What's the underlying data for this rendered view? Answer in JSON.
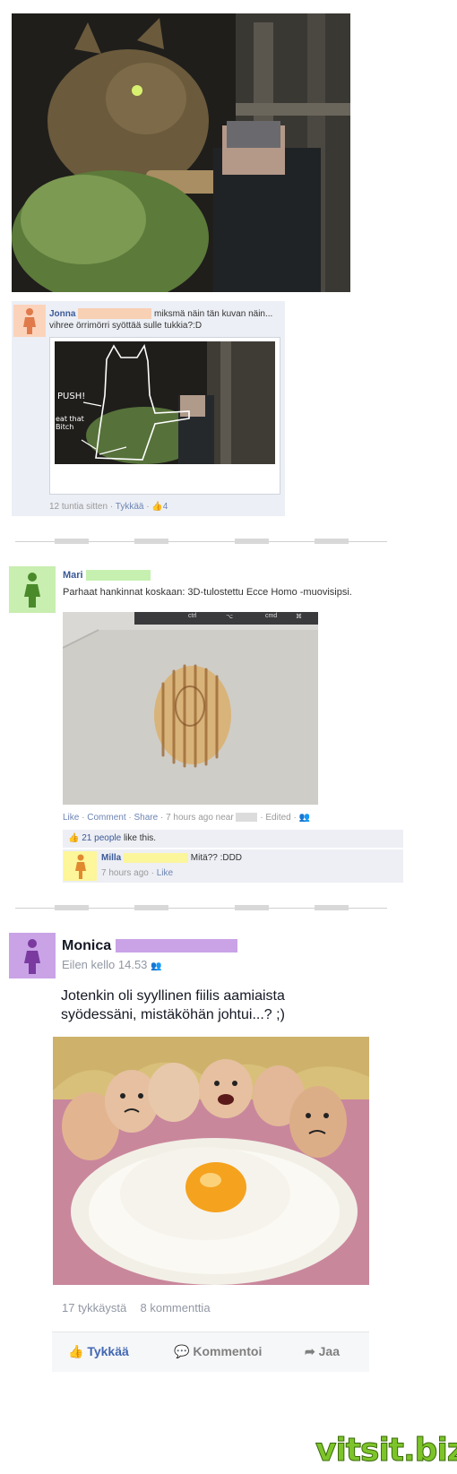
{
  "post1": {
    "comment": {
      "name": "Jonna",
      "text": "miksmä näin tän kuvan näin... vihree örrimörri syöttää sulle tukkia?:D",
      "time": "12 tuntia sitten",
      "like": "Tykkää",
      "likes": "4"
    },
    "doodle": {
      "push": "PUSH!",
      "eat": "eat that Bitch"
    }
  },
  "post2": {
    "name": "Mari",
    "text": "Parhaat hankinnat koskaan: 3D-tulostettu Ecce Homo -muovisipsi.",
    "actions": {
      "like": "Like",
      "comment": "Comment",
      "share": "Share",
      "time": "7 hours ago near",
      "edited": "Edited"
    },
    "keys": [
      "ctrl",
      "⌥",
      "cmd",
      "⌘"
    ],
    "likes_text": "21 people",
    "likes_suffix": "like this.",
    "reply": {
      "name": "Milla",
      "text": "Mitä?? :DDD",
      "time": "7 hours ago",
      "like": "Like"
    }
  },
  "post3": {
    "name": "Monica",
    "time": "Eilen kello 14.53",
    "text": "Jotenkin oli syyllinen fiilis aamiaista syödessäni, mistäköhän johtui...? ;)",
    "likes": "17 tykkäystä",
    "comments": "8 kommenttia",
    "actions": {
      "like": "Tykkää",
      "comment": "Kommentoi",
      "share": "Jaa"
    }
  },
  "watermark": "vitsit.biz",
  "colors": {
    "link": "#3b5998",
    "redact_orange": "#f8d0b4",
    "redact_green": "#c6f0b0",
    "redact_yellow": "#fbf59c",
    "redact_purple": "#c9a3e6",
    "watermark_green": "#7dc42a"
  }
}
